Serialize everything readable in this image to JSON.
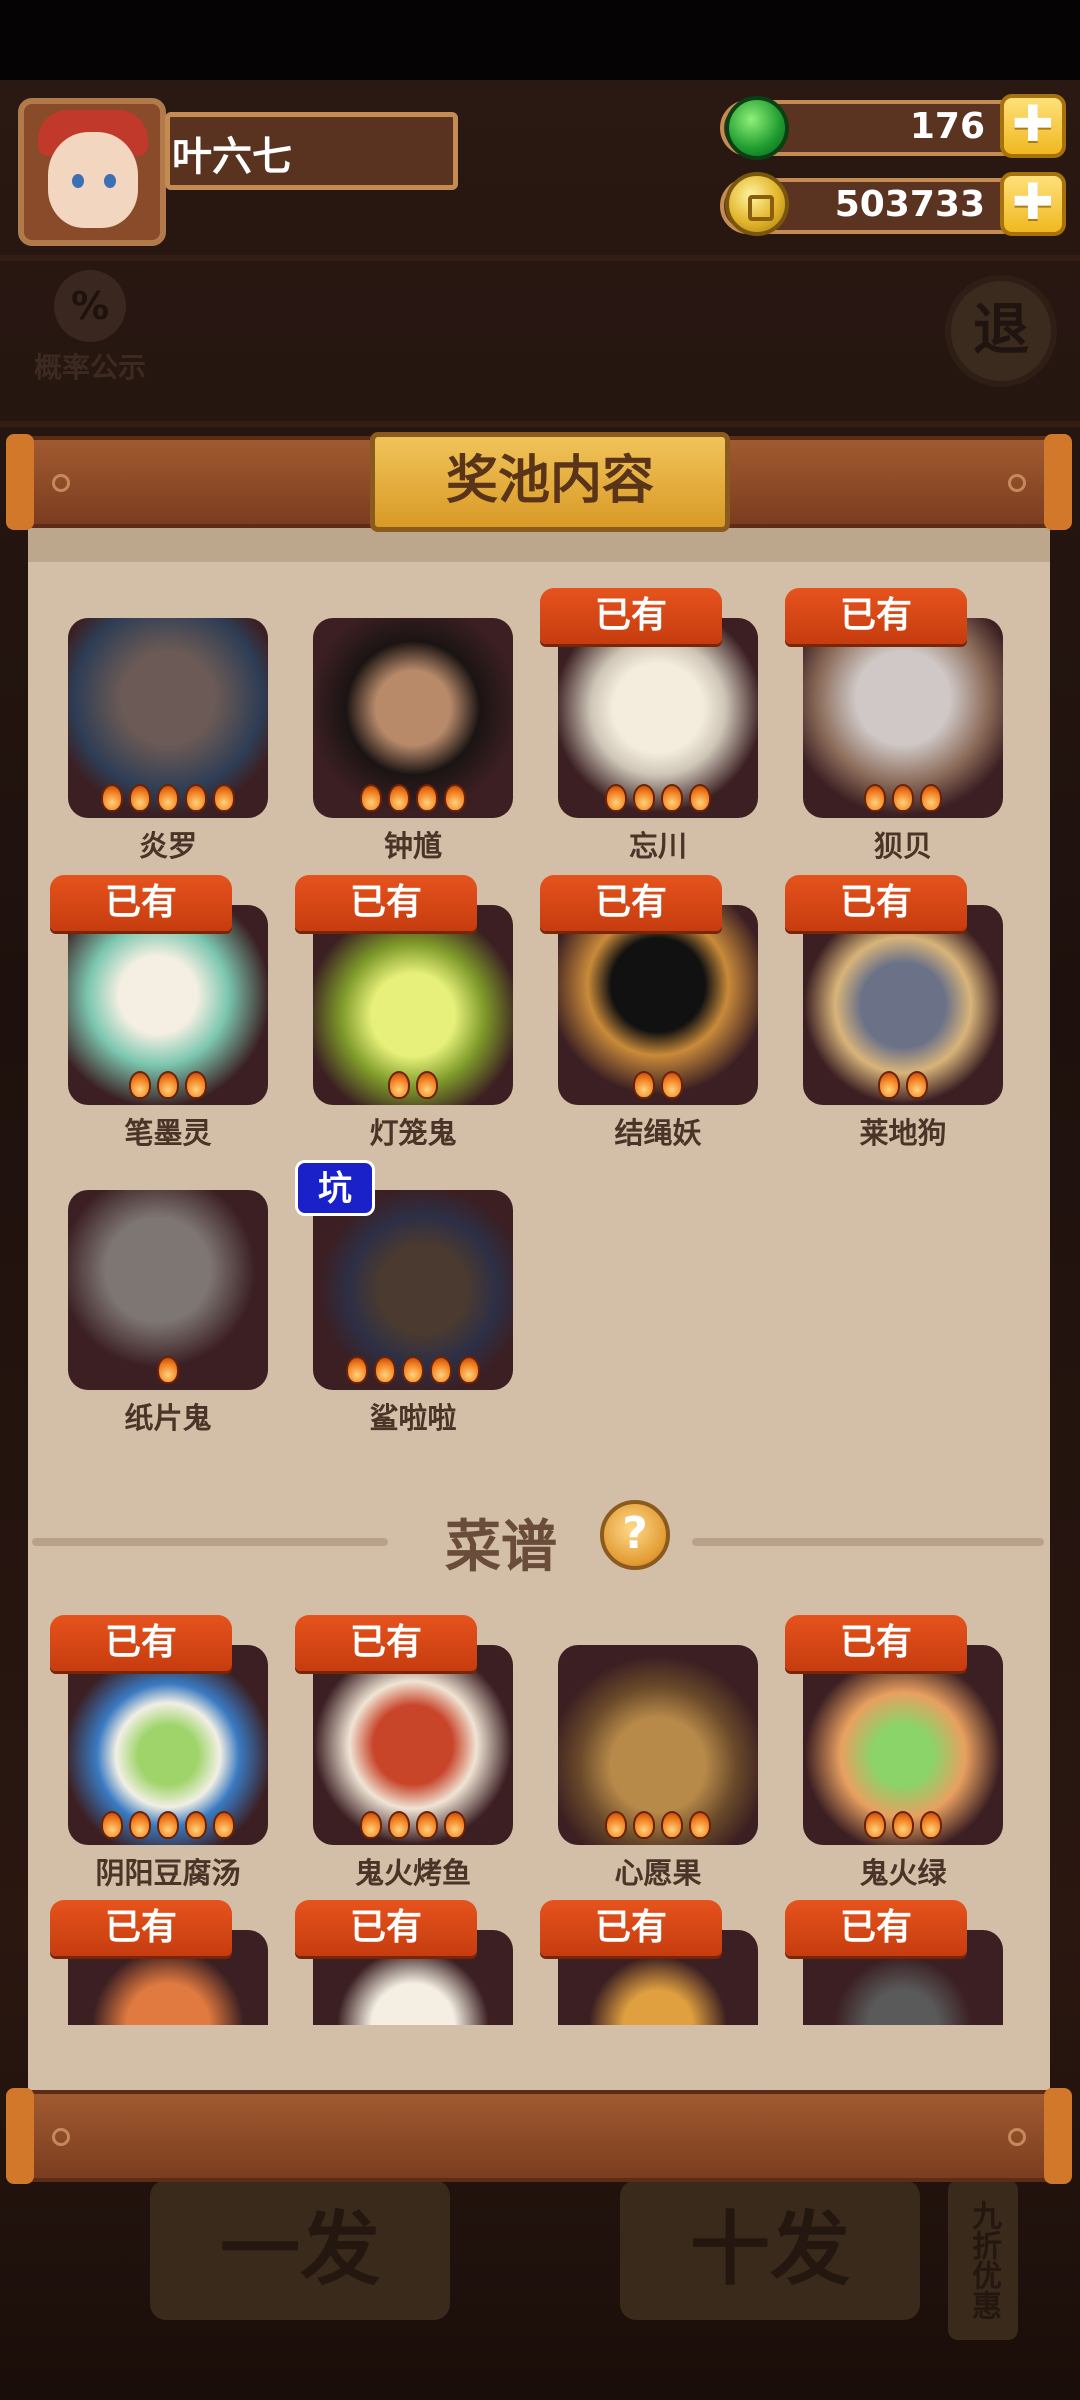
{
  "player": {
    "name": "叶六七"
  },
  "resources": {
    "gems": "176",
    "coins": "503733",
    "plus": "✚"
  },
  "background": {
    "probability_label": "概率公示",
    "probability_symbol": "%",
    "exit_label": "退",
    "single_draw_label": "一发",
    "ten_draw_label": "十发",
    "discount_label": "九折优惠"
  },
  "panel": {
    "title": "奖池内容",
    "owned_tag": "已有",
    "pit_tag": "坑",
    "characters": [
      {
        "name": "炎罗",
        "owned": false,
        "flames": 5
      },
      {
        "name": "钟馗",
        "owned": false,
        "flames": 4
      },
      {
        "name": "忘川",
        "owned": true,
        "flames": 4
      },
      {
        "name": "狈贝",
        "owned": true,
        "flames": 3
      },
      {
        "name": "笔墨灵",
        "owned": true,
        "flames": 3
      },
      {
        "name": "灯笼鬼",
        "owned": true,
        "flames": 2
      },
      {
        "name": "结绳妖",
        "owned": true,
        "flames": 2
      },
      {
        "name": "莱地狗",
        "owned": true,
        "flames": 2
      },
      {
        "name": "纸片鬼",
        "owned": false,
        "flames": 1
      },
      {
        "name": "鲨啦啦",
        "owned": false,
        "flames": 5,
        "pit": true
      }
    ],
    "recipes_title": "菜谱",
    "recipes": [
      {
        "name": "阴阳豆腐汤",
        "owned": true,
        "flames": 5
      },
      {
        "name": "鬼火烤鱼",
        "owned": true,
        "flames": 4
      },
      {
        "name": "心愿果",
        "owned": false,
        "flames": 4
      },
      {
        "name": "鬼火绿",
        "owned": true,
        "flames": 3
      },
      {
        "name": "",
        "owned": true,
        "flames": 0
      },
      {
        "name": "",
        "owned": true,
        "flames": 0
      },
      {
        "name": "",
        "owned": true,
        "flames": 0
      },
      {
        "name": "",
        "owned": true,
        "flames": 0
      }
    ]
  },
  "colors": {
    "owned_tag": "#d8461a",
    "pit_tag": "#1b21c9",
    "card_bg": "#3b1f22",
    "paper": "#d3bfa7"
  }
}
